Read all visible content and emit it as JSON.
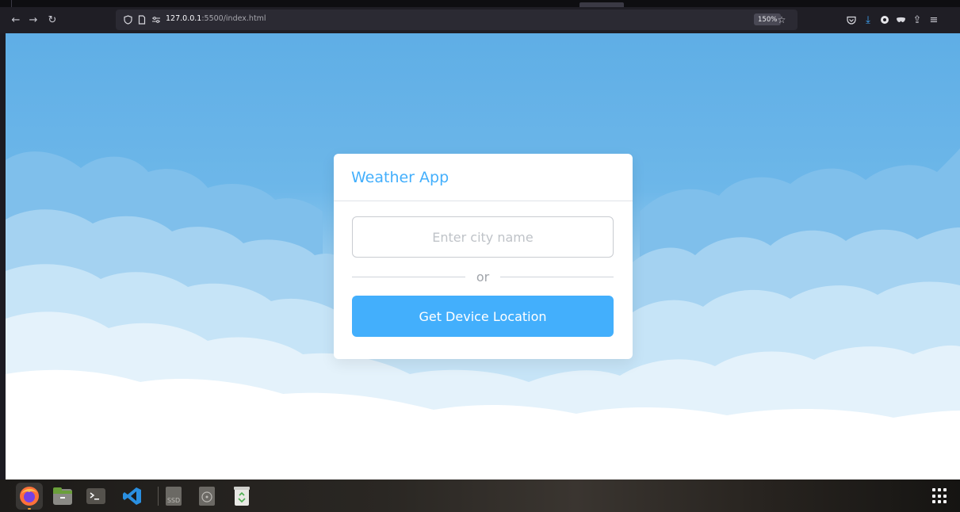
{
  "browser": {
    "url_host": "127.0.0.1",
    "url_path": ":5500/index.html",
    "zoom": "150%"
  },
  "app": {
    "title": "Weather App",
    "city_placeholder": "Enter city name",
    "or_text": "or",
    "location_button": "Get Device Location"
  },
  "colors": {
    "accent": "#43affc",
    "sky_top": "#5faee6"
  },
  "icons": {
    "back": "arrow-left-icon",
    "forward": "arrow-right-icon",
    "reload": "reload-icon",
    "shield": "shield-icon",
    "page": "page-icon",
    "permissions": "permissions-icon",
    "bookmark": "star-icon",
    "pocket": "pocket-icon",
    "downloads": "download-icon",
    "extension": "extension-icon",
    "private": "mask-icon",
    "share": "share-icon",
    "menu": "hamburger-menu-icon"
  }
}
